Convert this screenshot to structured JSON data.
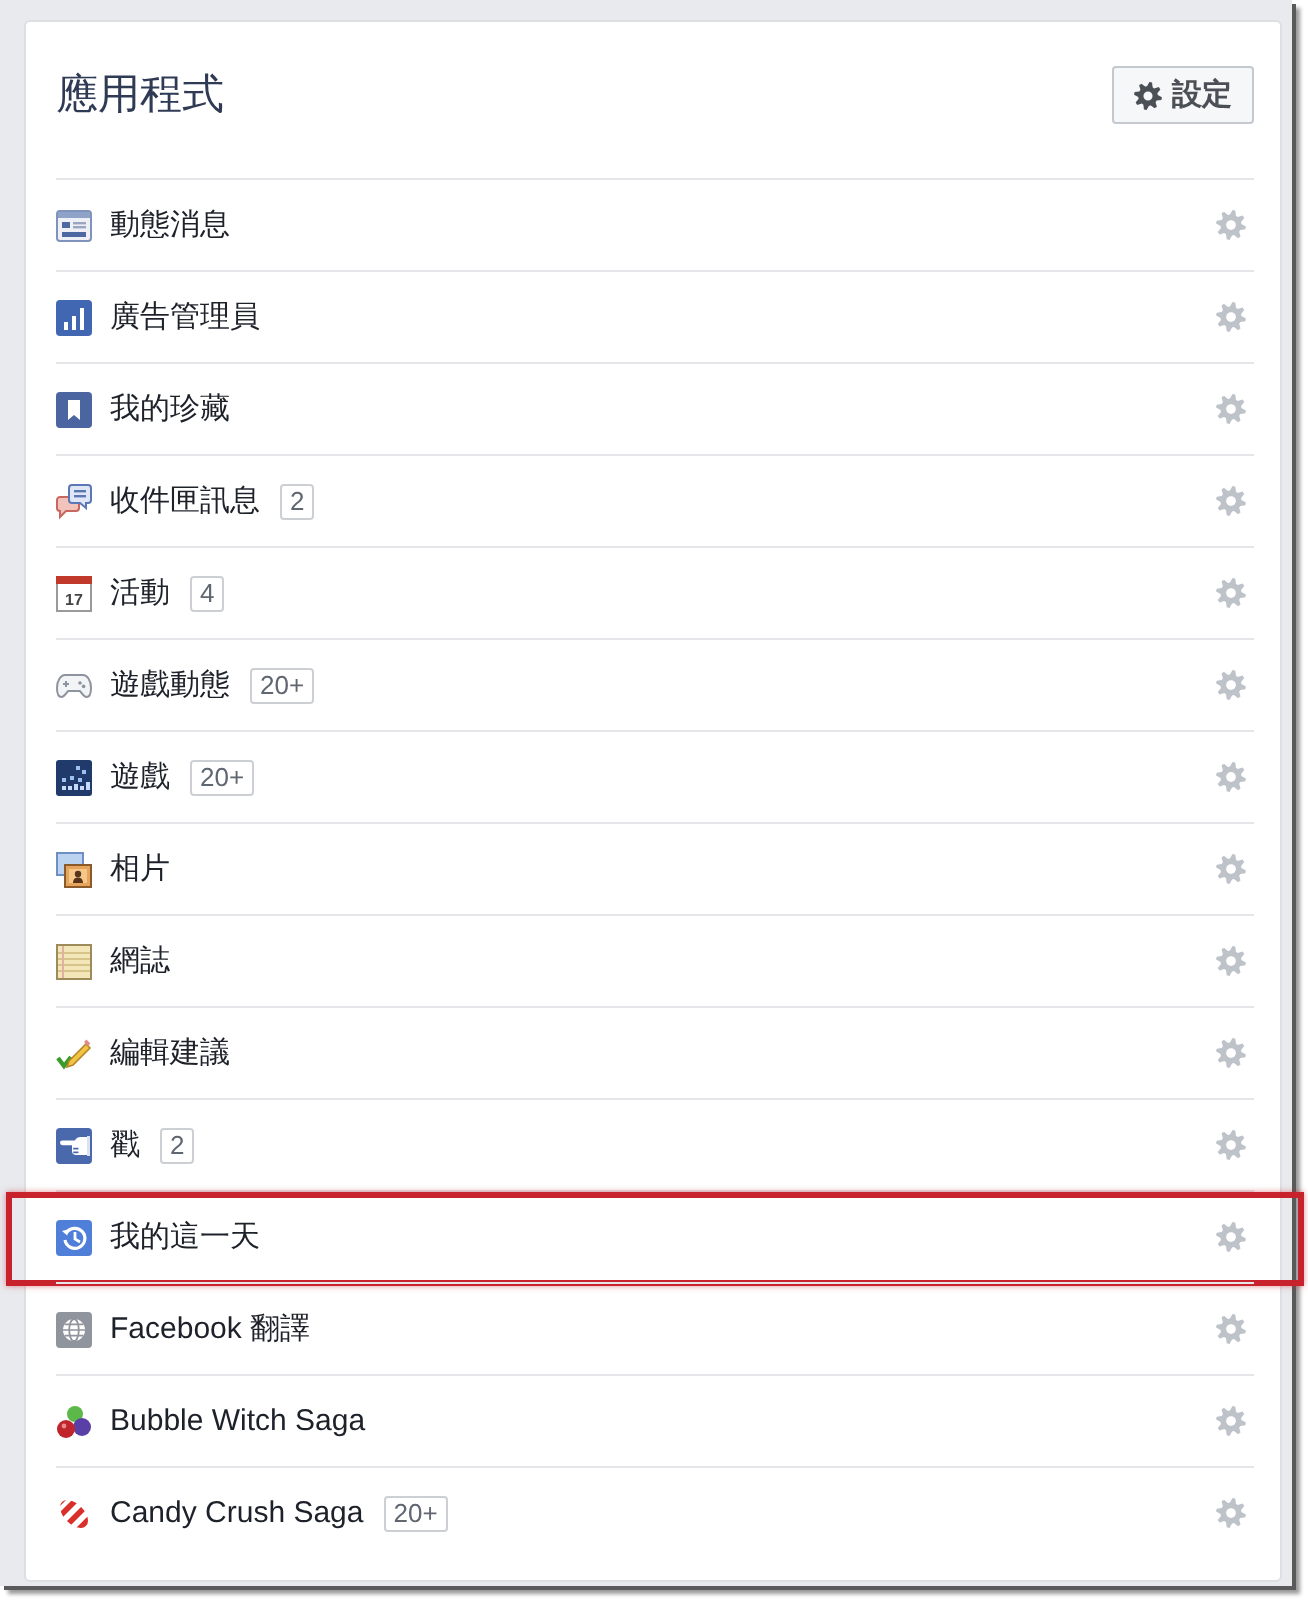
{
  "panel": {
    "title": "應用程式",
    "settings_button": "設定"
  },
  "apps": [
    {
      "label": "動態消息",
      "highlighted": false
    },
    {
      "label": "廣告管理員",
      "highlighted": false
    },
    {
      "label": "我的珍藏",
      "highlighted": false
    },
    {
      "label": "收件匣訊息",
      "count": "2",
      "highlighted": false
    },
    {
      "label": "活動",
      "count": "4",
      "icon_text": "17",
      "highlighted": false
    },
    {
      "label": "遊戲動態",
      "count": "20+",
      "highlighted": false
    },
    {
      "label": "遊戲",
      "count": "20+",
      "highlighted": false
    },
    {
      "label": "相片",
      "highlighted": false
    },
    {
      "label": "網誌",
      "highlighted": false
    },
    {
      "label": "編輯建議",
      "highlighted": false
    },
    {
      "label": "戳",
      "count": "2",
      "highlighted": false
    },
    {
      "label": "我的這一天",
      "highlighted": true
    },
    {
      "label": "Facebook 翻譯",
      "highlighted": false
    },
    {
      "label": "Bubble Witch Saga",
      "highlighted": false
    },
    {
      "label": "Candy Crush Saga",
      "count": "20+",
      "highlighted": false
    }
  ]
}
